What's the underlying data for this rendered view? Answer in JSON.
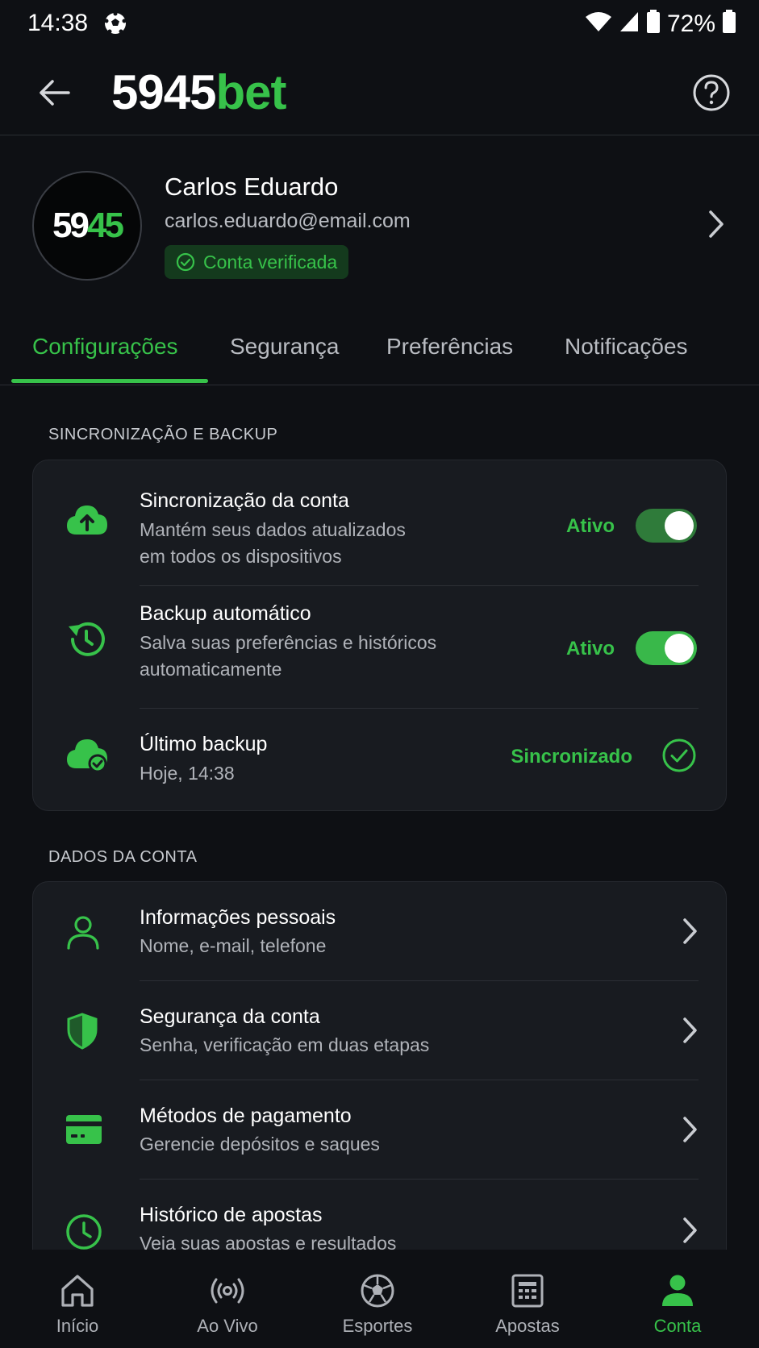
{
  "status_bar": {
    "time": "14:38",
    "battery": "72%"
  },
  "header": {
    "logo_main": "5945",
    "logo_accent": "bet"
  },
  "profile": {
    "avatar_main": "59",
    "avatar_accent": "45",
    "name": "Carlos Eduardo",
    "email": "carlos.eduardo@email.com",
    "badge": "Conta verificada"
  },
  "tabs": [
    {
      "label": "Configurações",
      "active": true
    },
    {
      "label": "Segurança",
      "active": false
    },
    {
      "label": "Preferências",
      "active": false
    },
    {
      "label": "Notificações",
      "active": false
    }
  ],
  "sync_section": {
    "title": "SINCRONIZAÇÃO E BACKUP",
    "items": [
      {
        "title": "Sincronização da conta",
        "subtitle_1": "Mantém seus dados atualizados",
        "subtitle_2": "em todos os dispositivos",
        "status": "Ativo",
        "toggle_on": true
      },
      {
        "title": "Backup automático",
        "subtitle_1": "Salva suas preferências e históricos",
        "subtitle_2": "automaticamente",
        "status": "Ativo",
        "toggle_on": true
      },
      {
        "title": "Último backup",
        "subtitle_1": "Hoje, 14:38",
        "status": "Sincronizado"
      }
    ]
  },
  "account_section": {
    "title": "DADOS DA CONTA",
    "items": [
      {
        "title": "Informações pessoais",
        "subtitle": "Nome, e-mail, telefone"
      },
      {
        "title": "Segurança da conta",
        "subtitle": "Senha, verificação em duas etapas"
      },
      {
        "title": "Métodos de pagamento",
        "subtitle": "Gerencie depósitos e saques"
      },
      {
        "title": "Histórico de apostas",
        "subtitle": "Veja suas apostas e resultados"
      }
    ]
  },
  "bottom_nav": [
    {
      "label": "Início",
      "icon": "home-icon"
    },
    {
      "label": "Ao Vivo",
      "icon": "live-icon"
    },
    {
      "label": "Esportes",
      "icon": "soccer-ball-icon"
    },
    {
      "label": "Apostas",
      "icon": "bet-slip-icon"
    },
    {
      "label": "Conta",
      "icon": "user-icon",
      "active": true
    }
  ],
  "colors": {
    "accent": "#37c24a",
    "background": "#0e1014",
    "card": "#181b20"
  }
}
